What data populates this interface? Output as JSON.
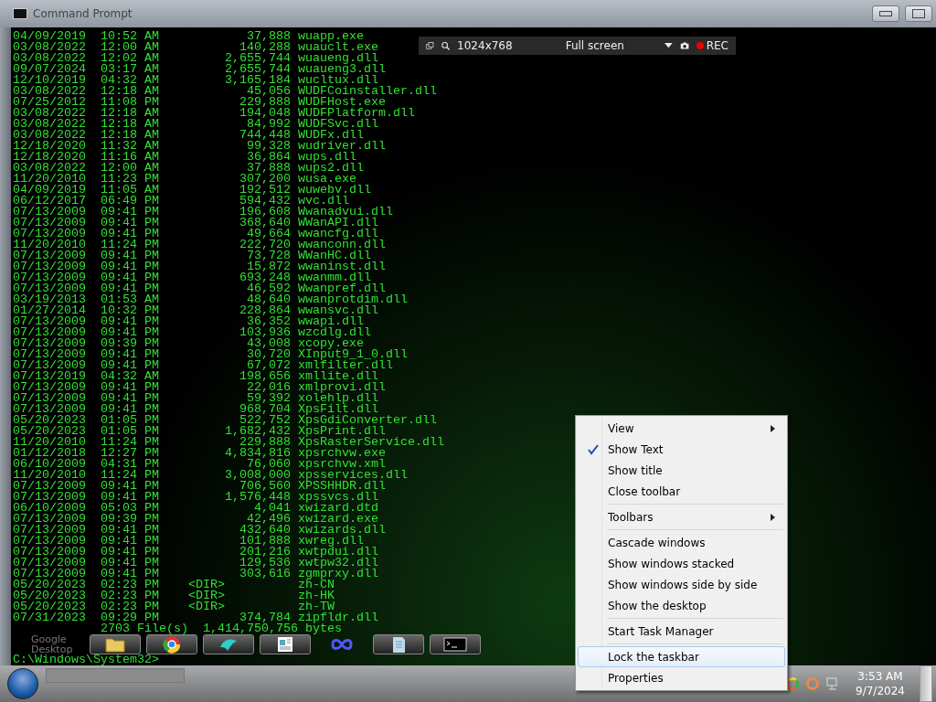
{
  "window": {
    "title": "Command Prompt"
  },
  "recorder_bar": {
    "resolution": "1024x768",
    "mode": "Full screen",
    "rec_label": "REC"
  },
  "console": {
    "rows": [
      {
        "date": "04/09/2019",
        "time": "10:52 AM",
        "size": "37,888",
        "name": "wuapp.exe"
      },
      {
        "date": "03/08/2022",
        "time": "12:00 AM",
        "size": "140,288",
        "name": "wuauclt.exe"
      },
      {
        "date": "03/08/2022",
        "time": "12:02 AM",
        "size": "2,655,744",
        "name": "wuaueng.dll"
      },
      {
        "date": "09/07/2024",
        "time": "03:17 AM",
        "size": "2,655,744",
        "name": "wuaueng3.dll"
      },
      {
        "date": "12/10/2019",
        "time": "04:32 AM",
        "size": "3,165,184",
        "name": "wucltux.dll"
      },
      {
        "date": "03/08/2022",
        "time": "12:18 AM",
        "size": "45,056",
        "name": "WUDFCoinstaller.dll"
      },
      {
        "date": "07/25/2012",
        "time": "11:08 PM",
        "size": "229,888",
        "name": "WUDFHost.exe"
      },
      {
        "date": "03/08/2022",
        "time": "12:18 AM",
        "size": "194,048",
        "name": "WUDFPlatform.dll"
      },
      {
        "date": "03/08/2022",
        "time": "12:18 AM",
        "size": "84,992",
        "name": "WUDFSvc.dll"
      },
      {
        "date": "03/08/2022",
        "time": "12:18 AM",
        "size": "744,448",
        "name": "WUDFx.dll"
      },
      {
        "date": "12/18/2020",
        "time": "11:32 AM",
        "size": "99,328",
        "name": "wudriver.dll"
      },
      {
        "date": "12/18/2020",
        "time": "11:16 AM",
        "size": "36,864",
        "name": "wups.dll"
      },
      {
        "date": "03/08/2022",
        "time": "12:00 AM",
        "size": "37,888",
        "name": "wups2.dll"
      },
      {
        "date": "11/20/2010",
        "time": "11:23 PM",
        "size": "307,200",
        "name": "wusa.exe"
      },
      {
        "date": "04/09/2019",
        "time": "11:05 AM",
        "size": "192,512",
        "name": "wuwebv.dll"
      },
      {
        "date": "06/12/2017",
        "time": "06:49 PM",
        "size": "594,432",
        "name": "wvc.dll"
      },
      {
        "date": "07/13/2009",
        "time": "09:41 PM",
        "size": "196,608",
        "name": "Wwanadvui.dll"
      },
      {
        "date": "07/13/2009",
        "time": "09:41 PM",
        "size": "368,640",
        "name": "WWanAPI.dll"
      },
      {
        "date": "07/13/2009",
        "time": "09:41 PM",
        "size": "49,664",
        "name": "wwancfg.dll"
      },
      {
        "date": "11/20/2010",
        "time": "11:24 PM",
        "size": "222,720",
        "name": "wwanconn.dll"
      },
      {
        "date": "07/13/2009",
        "time": "09:41 PM",
        "size": "73,728",
        "name": "WWanHC.dll"
      },
      {
        "date": "07/13/2009",
        "time": "09:41 PM",
        "size": "15,872",
        "name": "wwaninst.dll"
      },
      {
        "date": "07/13/2009",
        "time": "09:41 PM",
        "size": "693,248",
        "name": "wwanmm.dll"
      },
      {
        "date": "07/13/2009",
        "time": "09:41 PM",
        "size": "46,592",
        "name": "Wwanpref.dll"
      },
      {
        "date": "03/19/2013",
        "time": "01:53 AM",
        "size": "48,640",
        "name": "wwanprotdim.dll"
      },
      {
        "date": "01/27/2014",
        "time": "10:32 PM",
        "size": "228,864",
        "name": "wwansvc.dll"
      },
      {
        "date": "07/13/2009",
        "time": "09:41 PM",
        "size": "36,352",
        "name": "wwapi.dll"
      },
      {
        "date": "07/13/2009",
        "time": "09:41 PM",
        "size": "103,936",
        "name": "wzcdlg.dll"
      },
      {
        "date": "07/13/2009",
        "time": "09:39 PM",
        "size": "43,008",
        "name": "xcopy.exe"
      },
      {
        "date": "07/13/2009",
        "time": "09:41 PM",
        "size": "30,720",
        "name": "XInput9_1_0.dll"
      },
      {
        "date": "07/13/2009",
        "time": "09:41 PM",
        "size": "67,072",
        "name": "xmlfilter.dll"
      },
      {
        "date": "07/13/2019",
        "time": "04:32 AM",
        "size": "198,656",
        "name": "xmllite.dll"
      },
      {
        "date": "07/13/2009",
        "time": "09:41 PM",
        "size": "22,016",
        "name": "xmlprovi.dll"
      },
      {
        "date": "07/13/2009",
        "time": "09:41 PM",
        "size": "59,392",
        "name": "xolehlp.dll"
      },
      {
        "date": "07/13/2009",
        "time": "09:41 PM",
        "size": "968,704",
        "name": "XpsFilt.dll"
      },
      {
        "date": "05/20/2023",
        "time": "01:05 PM",
        "size": "522,752",
        "name": "XpsGdiConverter.dll"
      },
      {
        "date": "05/20/2023",
        "time": "01:05 PM",
        "size": "1,682,432",
        "name": "XpsPrint.dll"
      },
      {
        "date": "11/20/2010",
        "time": "11:24 PM",
        "size": "229,888",
        "name": "XpsRasterService.dll"
      },
      {
        "date": "01/12/2018",
        "time": "12:27 PM",
        "size": "4,834,816",
        "name": "xpsrchvw.exe"
      },
      {
        "date": "06/10/2009",
        "time": "04:31 PM",
        "size": "76,060",
        "name": "xpsrchvw.xml"
      },
      {
        "date": "11/20/2010",
        "time": "11:24 PM",
        "size": "3,008,000",
        "name": "xpsservices.dll"
      },
      {
        "date": "07/13/2009",
        "time": "09:41 PM",
        "size": "706,560",
        "name": "XPSSHHDR.dll"
      },
      {
        "date": "07/13/2009",
        "time": "09:41 PM",
        "size": "1,576,448",
        "name": "xpssvcs.dll"
      },
      {
        "date": "06/10/2009",
        "time": "05:03 PM",
        "size": "4,041",
        "name": "xwizard.dtd"
      },
      {
        "date": "07/13/2009",
        "time": "09:39 PM",
        "size": "42,496",
        "name": "xwizard.exe"
      },
      {
        "date": "07/13/2009",
        "time": "09:41 PM",
        "size": "432,640",
        "name": "xwizards.dll"
      },
      {
        "date": "07/13/2009",
        "time": "09:41 PM",
        "size": "101,888",
        "name": "xwreg.dll"
      },
      {
        "date": "07/13/2009",
        "time": "09:41 PM",
        "size": "201,216",
        "name": "xwtpdui.dll"
      },
      {
        "date": "07/13/2009",
        "time": "09:41 PM",
        "size": "129,536",
        "name": "xwtpw32.dll"
      },
      {
        "date": "07/13/2009",
        "time": "09:41 PM",
        "size": "303,616",
        "name": "zgmprxy.dll"
      },
      {
        "date": "05/20/2023",
        "time": "02:23 PM",
        "size": "<DIR>",
        "name": "zh-CN"
      },
      {
        "date": "05/20/2023",
        "time": "02:23 PM",
        "size": "<DIR>",
        "name": "zh-HK"
      },
      {
        "date": "05/20/2023",
        "time": "02:23 PM",
        "size": "<DIR>",
        "name": "zh-TW"
      },
      {
        "date": "07/31/2023",
        "time": "09:29 PM",
        "size": "374,784",
        "name": "zipfldr.dll"
      }
    ],
    "summary": "2703 File(s)  1,414,750,756 bytes",
    "prompt": "C:\\Windows\\System32>"
  },
  "desktop_label": "Google Desktop",
  "quick_launch": [
    {
      "kind": "folder"
    },
    {
      "kind": "browser"
    },
    {
      "kind": "bird"
    },
    {
      "kind": "document"
    },
    {
      "kind": "infinity"
    },
    {
      "kind": "notepad"
    },
    {
      "kind": "terminal"
    }
  ],
  "context_menu": {
    "items": [
      {
        "kind": "item",
        "label": "View",
        "checked": false,
        "submenu": true,
        "selected": false
      },
      {
        "kind": "item",
        "label": "Show Text",
        "checked": true,
        "submenu": false,
        "selected": false
      },
      {
        "kind": "item",
        "label": "Show title",
        "checked": false,
        "submenu": false,
        "selected": false
      },
      {
        "kind": "item",
        "label": "Close toolbar",
        "checked": false,
        "submenu": false,
        "selected": false
      },
      {
        "kind": "separator"
      },
      {
        "kind": "item",
        "label": "Toolbars",
        "checked": false,
        "submenu": true,
        "selected": false
      },
      {
        "kind": "separator"
      },
      {
        "kind": "item",
        "label": "Cascade windows",
        "checked": false,
        "submenu": false,
        "selected": false
      },
      {
        "kind": "item",
        "label": "Show windows stacked",
        "checked": false,
        "submenu": false,
        "selected": false
      },
      {
        "kind": "item",
        "label": "Show windows side by side",
        "checked": false,
        "submenu": false,
        "selected": false
      },
      {
        "kind": "item",
        "label": "Show the desktop",
        "checked": false,
        "submenu": false,
        "selected": false
      },
      {
        "kind": "separator"
      },
      {
        "kind": "item",
        "label": "Start Task Manager",
        "checked": false,
        "submenu": false,
        "selected": false
      },
      {
        "kind": "separator"
      },
      {
        "kind": "item",
        "label": "Lock the taskbar",
        "checked": false,
        "submenu": false,
        "selected": true
      },
      {
        "kind": "item",
        "label": "Properties",
        "checked": false,
        "submenu": false,
        "selected": false
      }
    ]
  },
  "taskbar": {
    "time": "3:53 AM",
    "date": "9/7/2024"
  }
}
